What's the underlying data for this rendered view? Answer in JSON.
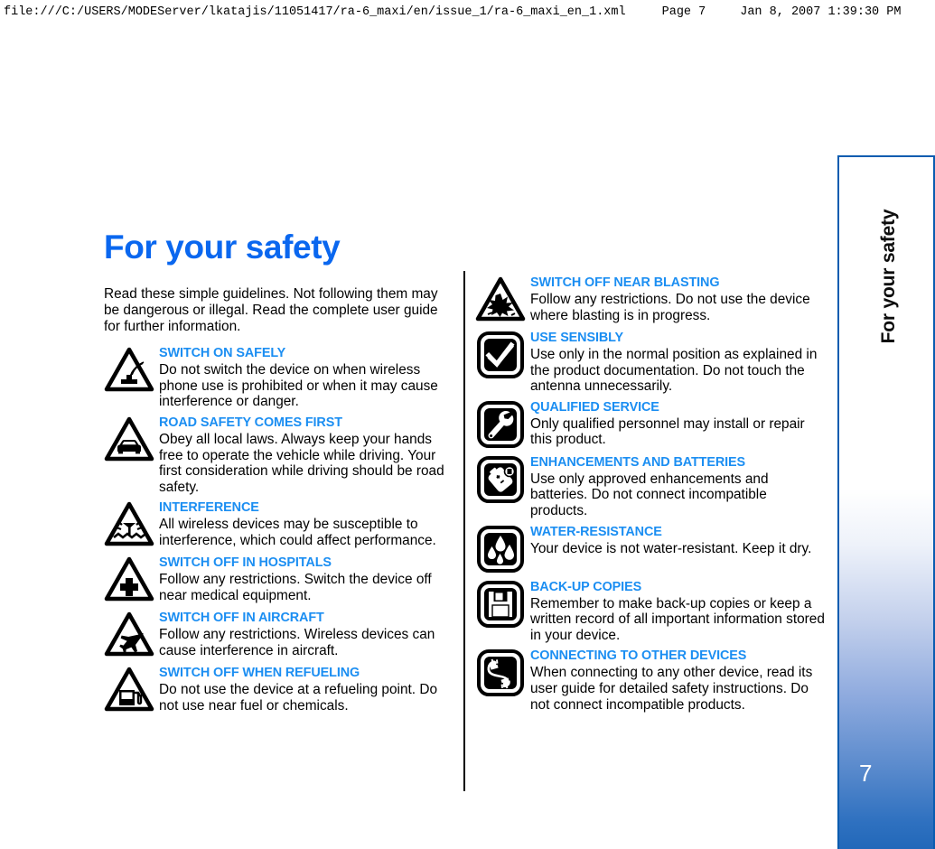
{
  "print_header": {
    "url": "file:///C:/USERS/MODEServer/lkatajis/11051417/ra-6_maxi/en/issue_1/ra-6_maxi_en_1.xml",
    "page": "Page 7",
    "date": "Jan 8, 2007 1:39:30 PM"
  },
  "page": {
    "title": "For your safety",
    "title_color": "#0a67ef",
    "heading_color": "#1b8ef2",
    "intro": "Read these simple guidelines. Not following them may be dangerous or illegal. Read the complete user guide for further information.",
    "sidebar_label": "For your safety",
    "page_number": "7",
    "sidebar_accent": "#2268b9",
    "sidebar_border": "#0a5cb0"
  },
  "left_column": [
    {
      "icon": "switch-on-safely-icon",
      "heading": "SWITCH ON SAFELY",
      "body": "Do not switch the device on when wireless phone use is prohibited or when it may cause interference or danger."
    },
    {
      "icon": "road-safety-icon",
      "heading": "ROAD SAFETY COMES FIRST",
      "body": "Obey all local laws. Always keep your hands free to operate the vehicle while driving. Your first consideration while driving should be road safety."
    },
    {
      "icon": "interference-icon",
      "heading": "INTERFERENCE",
      "body": "All wireless devices may be susceptible to interference, which could affect performance."
    },
    {
      "icon": "hospital-icon",
      "heading": "SWITCH OFF IN HOSPITALS",
      "body": "Follow any restrictions. Switch the device off near medical equipment."
    },
    {
      "icon": "aircraft-icon",
      "heading": "SWITCH OFF IN AIRCRAFT",
      "body": "Follow any restrictions. Wireless devices can cause interference in aircraft."
    },
    {
      "icon": "refueling-icon",
      "heading": "SWITCH OFF WHEN REFUELING",
      "body": "Do not use the device at a refueling point. Do not use near fuel or chemicals."
    }
  ],
  "right_column": [
    {
      "icon": "blasting-icon",
      "heading": "SWITCH OFF NEAR BLASTING",
      "body": "Follow any restrictions. Do not use the device where blasting is in progress."
    },
    {
      "icon": "use-sensibly-check-icon",
      "heading": "USE SENSIBLY",
      "body": "Use only in the normal position as explained in the product documentation. Do not touch the antenna unnecessarily."
    },
    {
      "icon": "qualified-service-wrench-icon",
      "heading": "QUALIFIED SERVICE",
      "body": "Only qualified personnel may install or repair this product."
    },
    {
      "icon": "battery-icon",
      "heading": "ENHANCEMENTS AND BATTERIES",
      "body": "Use only approved enhancements and batteries. Do not connect incompatible products."
    },
    {
      "icon": "water-resistance-droplets-icon",
      "heading": "WATER-RESISTANCE",
      "body": "Your device is not water-resistant. Keep it dry."
    },
    {
      "icon": "back-up-copies-floppy-icon",
      "heading": "BACK-UP COPIES",
      "body": "Remember to make back-up copies or keep a written record of all important information stored in your device."
    },
    {
      "icon": "connecting-devices-plug-icon",
      "heading": "CONNECTING TO OTHER DEVICES",
      "body": "When connecting to any other device, read its user guide for detailed safety instructions. Do not connect incompatible products."
    }
  ]
}
